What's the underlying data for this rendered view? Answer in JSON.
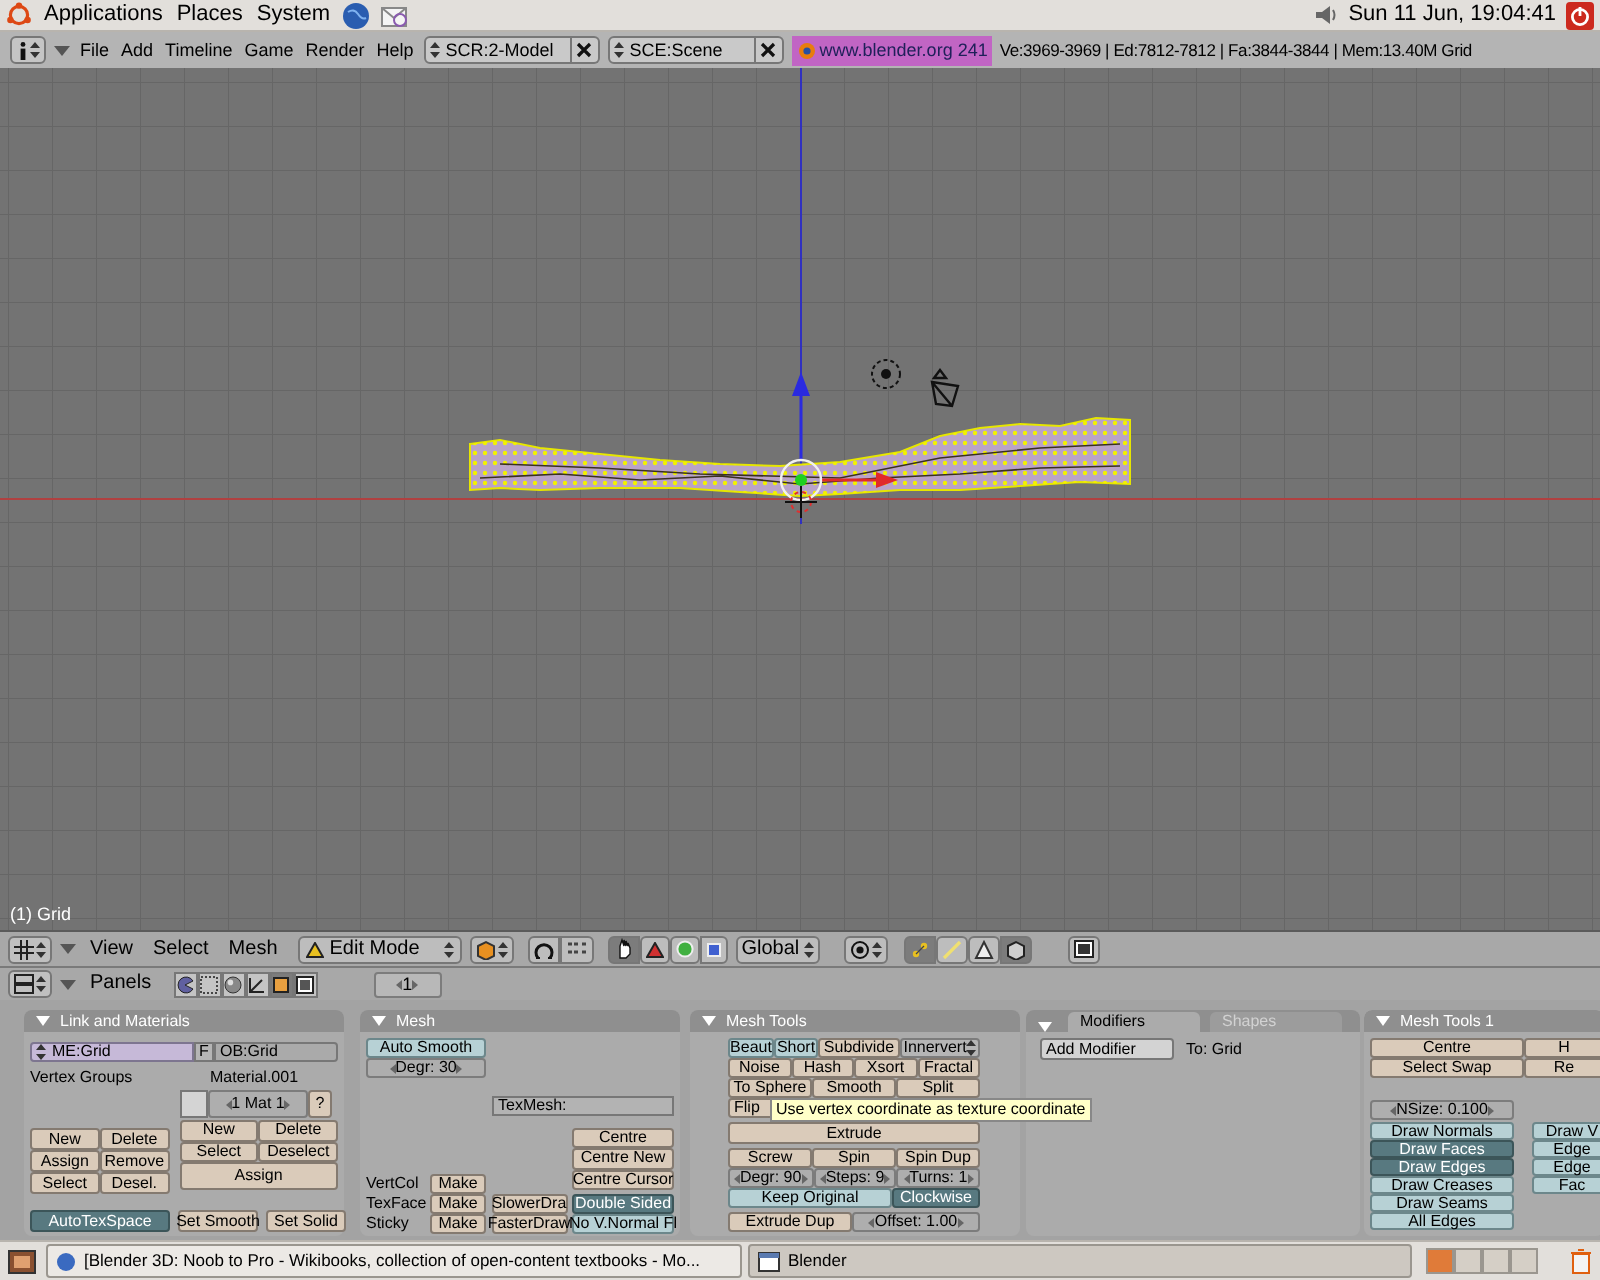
{
  "top_panel": {
    "menus": [
      "Applications",
      "Places",
      "System"
    ],
    "clock": "Sun 11 Jun, 19:04:41"
  },
  "info_header": {
    "menus": [
      "File",
      "Add",
      "Timeline",
      "Game",
      "Render",
      "Help"
    ],
    "screen": "SCR:2-Model",
    "scene": "SCE:Scene",
    "version": "www.blender.org 241",
    "stats": "Ve:3969-3969 | Ed:7812-7812 | Fa:3844-3844 | Mem:13.40M Grid"
  },
  "viewport": {
    "object_label": "(1) Grid"
  },
  "viewport_header": {
    "menus": [
      "View",
      "Select",
      "Mesh"
    ],
    "mode": "Edit Mode",
    "transform_orientation": "Global",
    "manipulator_on": true,
    "select_modes": [
      {
        "selected": true
      },
      {
        "selected": false
      },
      {
        "selected": false
      }
    ],
    "limit_to_visible": true
  },
  "buttons_header": {
    "menu": "Panels",
    "contexts": [
      {
        "selected": false
      },
      {
        "selected": false
      },
      {
        "selected": false
      },
      {
        "selected": false
      },
      {
        "selected": true
      },
      {
        "selected": false
      }
    ],
    "frame": "1"
  },
  "panels": [
    {
      "kind": "link_materials",
      "title": "Link and Materials",
      "mesh_name": "ME:Grid",
      "fake_user": "F",
      "object_name": "OB:Grid",
      "vertex_groups_label": "Vertex Groups",
      "material_name": "Material.001",
      "material_index": "1 Mat 1",
      "help": "?",
      "group_buttons": [
        "New",
        "Delete",
        "Assign",
        "Remove",
        "Select",
        "Desel."
      ],
      "material_buttons": [
        "New",
        "Delete",
        "Select",
        "Deselect",
        "Assign"
      ],
      "auto_tex_space": {
        "label": "AutoTexSpace",
        "on": true
      },
      "smooth_buttons": [
        "Set Smooth",
        "Set Solid"
      ]
    },
    {
      "kind": "mesh",
      "title": "Mesh",
      "auto_smooth": {
        "label": "Auto Smooth",
        "on": false
      },
      "degree": "Degr: 30",
      "tex_mesh": "TexMesh:",
      "centre_buttons": [
        "Centre",
        "Centre New",
        "Centre Cursor"
      ],
      "layers": [
        {
          "label": "VertCol",
          "button": "Make"
        },
        {
          "label": "TexFace",
          "button": "Make"
        },
        {
          "label": "Sticky",
          "button": "Make"
        }
      ],
      "draw_speed_buttons": [
        "SlowerDra",
        "FasterDraw"
      ],
      "toggles": [
        {
          "label": "Double Sided",
          "on": true
        },
        {
          "label": "No V.Normal Fl",
          "on": false
        }
      ]
    },
    {
      "kind": "mesh_tools",
      "title": "Mesh Tools",
      "tool_rows": [
        [
          {
            "label": "Beaut",
            "kind": "toggle",
            "on": false
          },
          {
            "label": "Short",
            "kind": "toggle",
            "on": false
          },
          {
            "label": "Subdivide",
            "kind": "button"
          },
          {
            "label": "Innervert",
            "kind": "menu"
          }
        ],
        [
          {
            "label": "Noise",
            "kind": "button"
          },
          {
            "label": "Hash",
            "kind": "button"
          },
          {
            "label": "Xsort",
            "kind": "button"
          },
          {
            "label": "Fractal",
            "kind": "button"
          }
        ],
        [
          {
            "label": "To Sphere",
            "kind": "button"
          },
          {
            "label": "Smooth",
            "kind": "button"
          },
          {
            "label": "Split",
            "kind": "button"
          }
        ],
        [
          {
            "label": "Flip",
            "kind": "button"
          }
        ]
      ],
      "tooltip": "Use vertex coordinate as texture coordinate",
      "extrude": "Extrude",
      "spin_buttons": [
        "Screw",
        "Spin",
        "Spin Dup"
      ],
      "spin_settings": [
        "Degr: 90",
        "Steps: 9",
        "Turns: 1"
      ],
      "keep_original": {
        "label": "Keep Original",
        "on": false
      },
      "clockwise": {
        "label": "Clockwise",
        "on": true
      },
      "extrude_dup": "Extrude Dup",
      "offset": "Offset: 1.00"
    },
    {
      "kind": "modifiers",
      "tabs": [
        {
          "label": "Modifiers",
          "selected": true
        },
        {
          "label": "Shapes",
          "selected": false
        }
      ],
      "add_modifier": "Add Modifier",
      "target": "To: Grid"
    },
    {
      "kind": "mesh_tools_1",
      "title": "Mesh Tools 1",
      "buttons": [
        "Centre",
        "H",
        "Select Swap",
        "Re"
      ],
      "normal_size": "NSize: 0.100",
      "draw_toggles": [
        {
          "label": "Draw Normals",
          "on": false
        },
        {
          "label": "Draw Faces",
          "on": true
        },
        {
          "label": "Draw Edges",
          "on": true
        },
        {
          "label": "Draw Creases",
          "on": false
        },
        {
          "label": "Draw Seams",
          "on": false
        },
        {
          "label": "All Edges",
          "on": false
        }
      ],
      "draw_toggles_2": [
        {
          "label": "Draw V",
          "on": false
        },
        {
          "label": "Edge",
          "on": false
        },
        {
          "label": "Edge",
          "on": false
        },
        {
          "label": "Fac",
          "on": false
        }
      ]
    }
  ],
  "taskbar": {
    "windows": [
      {
        "label": "[Blender 3D: Noob to Pro - Wikibooks, collection of open-content textbooks - Mo...",
        "selected": false
      },
      {
        "label": "Blender",
        "selected": true
      }
    ],
    "workspaces": [
      {
        "selected": true
      },
      {
        "selected": false
      },
      {
        "selected": false
      },
      {
        "selected": false
      }
    ]
  }
}
